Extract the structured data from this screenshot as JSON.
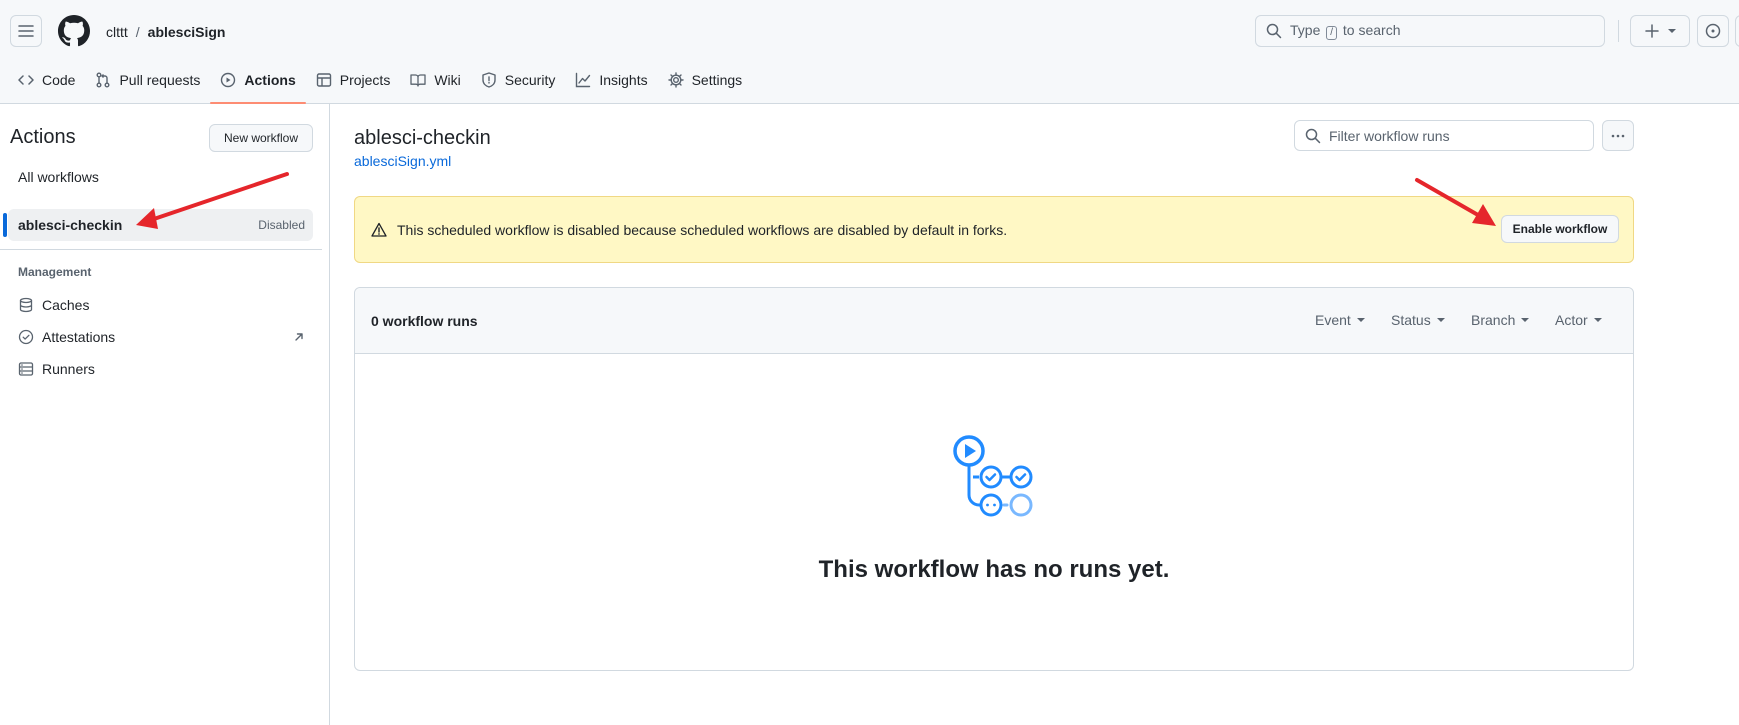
{
  "header": {
    "owner": "clttt",
    "separator": "/",
    "repo": "ablesciSign",
    "search": {
      "prefix": "Type",
      "key": "/",
      "suffix": "to search"
    }
  },
  "tabs": [
    {
      "label": "Code",
      "icon": "code-icon"
    },
    {
      "label": "Pull requests",
      "icon": "pull-request-icon"
    },
    {
      "label": "Actions",
      "icon": "play-icon",
      "active": true
    },
    {
      "label": "Projects",
      "icon": "table-icon"
    },
    {
      "label": "Wiki",
      "icon": "book-icon"
    },
    {
      "label": "Security",
      "icon": "shield-icon"
    },
    {
      "label": "Insights",
      "icon": "graph-icon"
    },
    {
      "label": "Settings",
      "icon": "gear-icon"
    }
  ],
  "sidebar": {
    "title": "Actions",
    "new_workflow": "New workflow",
    "all_workflows": "All workflows",
    "selected_workflow": {
      "label": "ablesci-checkin",
      "badge": "Disabled"
    },
    "management_heading": "Management",
    "management": [
      {
        "label": "Caches",
        "icon": "database-icon"
      },
      {
        "label": "Attestations",
        "icon": "verified-icon"
      },
      {
        "label": "Runners",
        "icon": "server-icon"
      }
    ]
  },
  "main": {
    "title": "ablesci-checkin",
    "file": "ablesciSign.yml",
    "filter_placeholder": "Filter workflow runs",
    "flash_text": "This scheduled workflow is disabled because scheduled workflows are disabled by default in forks.",
    "enable_button": "Enable workflow",
    "runs_count": "0 workflow runs",
    "filters": [
      "Event",
      "Status",
      "Branch",
      "Actor"
    ],
    "blank_text": "This workflow has no runs yet."
  },
  "colors": {
    "accent": "#0969da",
    "tab_underline": "#fd8c73",
    "flash_bg": "#fff8c5",
    "annotation_arrow": "#e5262b"
  }
}
